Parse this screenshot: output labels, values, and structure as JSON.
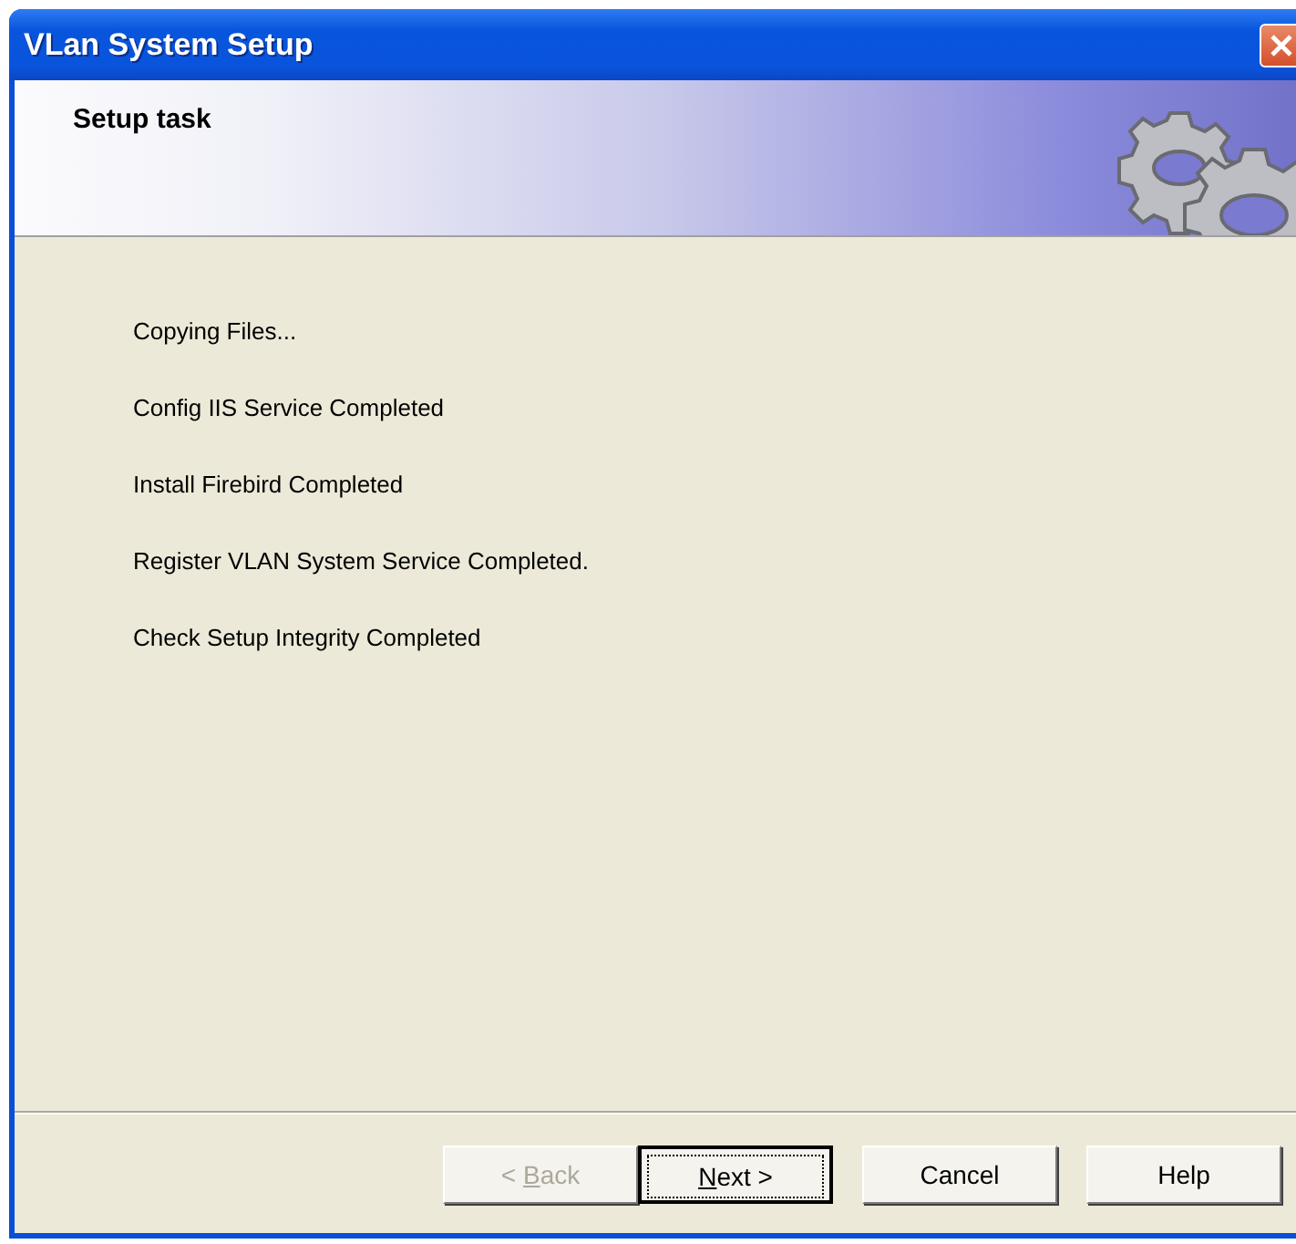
{
  "window": {
    "title": "VLan System Setup"
  },
  "header": {
    "title": "Setup task"
  },
  "messages": [
    "Copying Files...",
    "Config IIS Service Completed",
    "Install Firebird Completed",
    "Register VLAN System Service Completed.",
    "Check Setup Integrity Completed"
  ],
  "buttons": [
    {
      "label": {
        "pre": "< ",
        "key": "B",
        "post": "ack"
      },
      "disabled": true,
      "default": false
    },
    {
      "label": {
        "key": "N",
        "post": "ext >"
      },
      "disabled": false,
      "default": true
    },
    {
      "label": {
        "pre": "Cancel"
      },
      "disabled": false,
      "default": false
    },
    {
      "label": {
        "pre": "Help"
      },
      "disabled": false,
      "default": false
    }
  ]
}
